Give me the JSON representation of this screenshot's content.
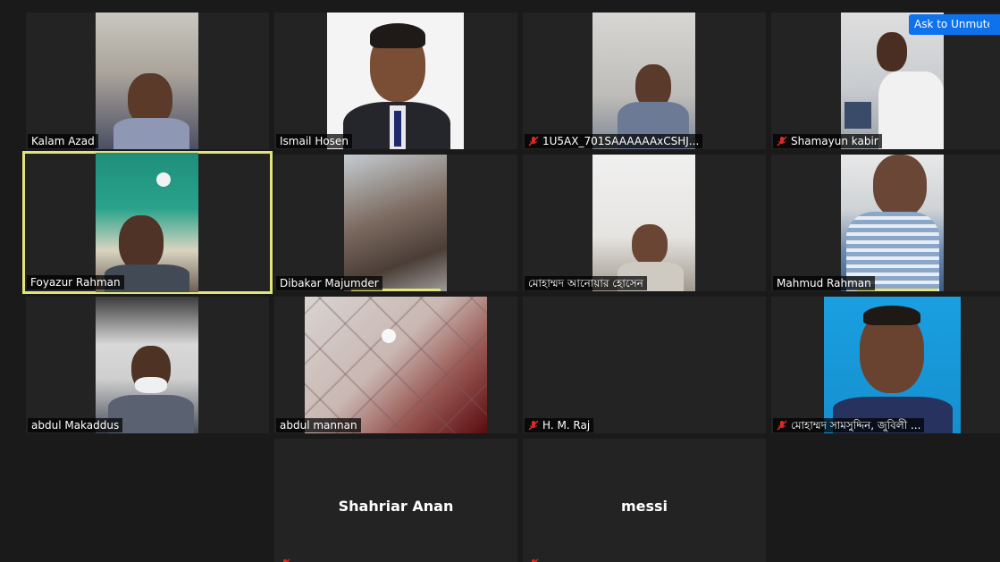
{
  "ask_to_unmute": "Ask to Unmute",
  "participants": [
    {
      "name": "Kalam Azad",
      "muted": false
    },
    {
      "name": "Ismail Hosen",
      "muted": false
    },
    {
      "name": "1U5AX_701SAAAAAAxCSHJ...",
      "muted": true
    },
    {
      "name": "Shamayun kabir",
      "muted": true
    },
    {
      "name": "Foyazur Rahman",
      "muted": false,
      "active_speaker": true
    },
    {
      "name": "Dibakar Majumder",
      "muted": false
    },
    {
      "name": "মোহাম্মদ আনোয়ার হোসেন",
      "muted": false
    },
    {
      "name": "Mahmud Rahman",
      "muted": false
    },
    {
      "name": "abdul Makaddus",
      "muted": false
    },
    {
      "name": "abdul mannan",
      "muted": false
    },
    {
      "name": "H. M. Raj",
      "muted": true
    },
    {
      "name": "মোহাম্মদ সামসুদ্দিন, জুবিলী ...",
      "muted": true
    },
    {
      "name": "Shahriar Anan",
      "muted": true,
      "video_off": true
    },
    {
      "name": "messi",
      "muted": true,
      "video_off": true
    }
  ],
  "colors": {
    "active_border": "#e2e37a",
    "button": "#0e72ed",
    "mute": "#e02828"
  }
}
